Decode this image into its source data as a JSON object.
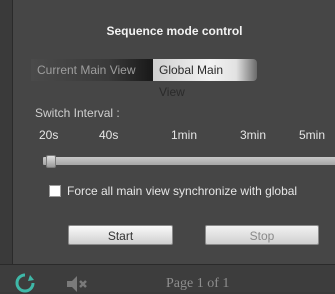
{
  "dialog": {
    "title": "Sequence mode control",
    "tabs": [
      {
        "label": "Current Main View",
        "selected": false
      },
      {
        "label": "Global Main View",
        "selected": true
      }
    ],
    "switch_interval": {
      "label": "Switch Interval :",
      "ticks": [
        "20s",
        "40s",
        "1min",
        "3min",
        "5min"
      ],
      "selected_value": "20s"
    },
    "force_sync": {
      "label": "Force all main view synchronize with global",
      "checked": false
    },
    "buttons": {
      "start": "Start",
      "stop": "Stop"
    }
  },
  "footer": {
    "page_info": "Page 1 of 1",
    "icons": [
      "refresh-icon",
      "mute-icon"
    ]
  }
}
